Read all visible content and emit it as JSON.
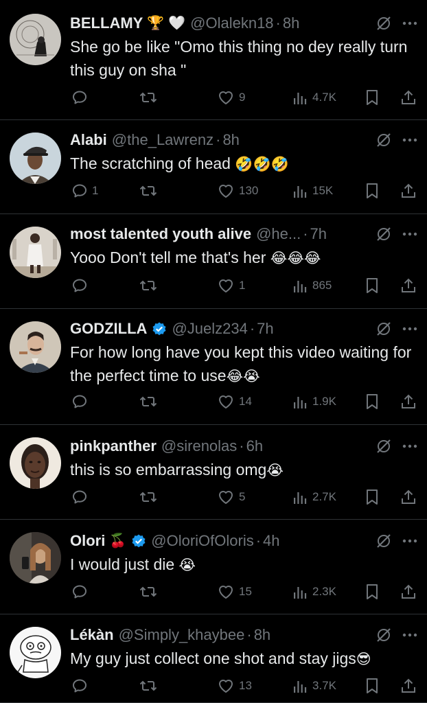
{
  "colors": {
    "background": "#000000",
    "text": "#e7e9ea",
    "muted": "#71767b",
    "divider": "#2f3336",
    "verified": "#1d9bf0"
  },
  "tweets": [
    {
      "name": "BELLAMY",
      "badges": [
        "🏆",
        "🤍"
      ],
      "verified": false,
      "handle": "@Olalekn18",
      "sep": "·",
      "time": "8h",
      "text": "She go be like \"Omo this thing no dey really turn this guy on sha \"",
      "emojis": "",
      "replies": "",
      "likes": "9",
      "views": "4.7K",
      "avatar_icon": "sketch-avatar"
    },
    {
      "name": "Alabi",
      "badges": [],
      "verified": false,
      "handle": "@the_Lawrenz",
      "sep": "·",
      "time": "8h",
      "text": "The scratching of head ",
      "emojis": "🤣🤣🤣",
      "replies": "1",
      "likes": "130",
      "views": "15K",
      "avatar_icon": "man-cap-avatar"
    },
    {
      "name": "most talented youth alive",
      "badges": [],
      "verified": false,
      "handle": "@he...",
      "sep": "·",
      "time": "7h",
      "text": "Yooo Don't tell me that's her ",
      "emojis": "😂😂😂",
      "replies": "",
      "likes": "1",
      "views": "865",
      "avatar_icon": "standing-figure-avatar"
    },
    {
      "name": "GODZILLA",
      "badges": [],
      "verified": true,
      "handle": "@Juelz234",
      "sep": "·",
      "time": "7h",
      "text": "For how long have you kept this video waiting for the perfect time to use",
      "emojis": "😂😭",
      "replies": "",
      "likes": "14",
      "views": "1.9K",
      "avatar_icon": "illustrated-man-avatar"
    },
    {
      "name": "pinkpanther",
      "badges": [],
      "verified": false,
      "handle": "@sirenolas",
      "sep": "·",
      "time": "6h",
      "text": "this is so embarrassing omg",
      "emojis": "😭",
      "replies": "",
      "likes": "5",
      "views": "2.7K",
      "avatar_icon": "woman-face-avatar"
    },
    {
      "name": "Olori",
      "badges": [
        "🍒"
      ],
      "verified": true,
      "handle": "@OloriOfOloris",
      "sep": "·",
      "time": "4h",
      "text": "I would just die ",
      "emojis": "😭",
      "replies": "",
      "likes": "15",
      "views": "2.3K",
      "avatar_icon": "mirror-selfie-avatar"
    },
    {
      "name": "Lékàn",
      "badges": [],
      "verified": false,
      "handle": "@Simply_khaybee",
      "sep": "·",
      "time": "8h",
      "text": "My guy just collect one shot and stay jigs",
      "emojis": "😎",
      "replies": "",
      "likes": "13",
      "views": "3.7K",
      "avatar_icon": "meme-face-avatar"
    }
  ]
}
